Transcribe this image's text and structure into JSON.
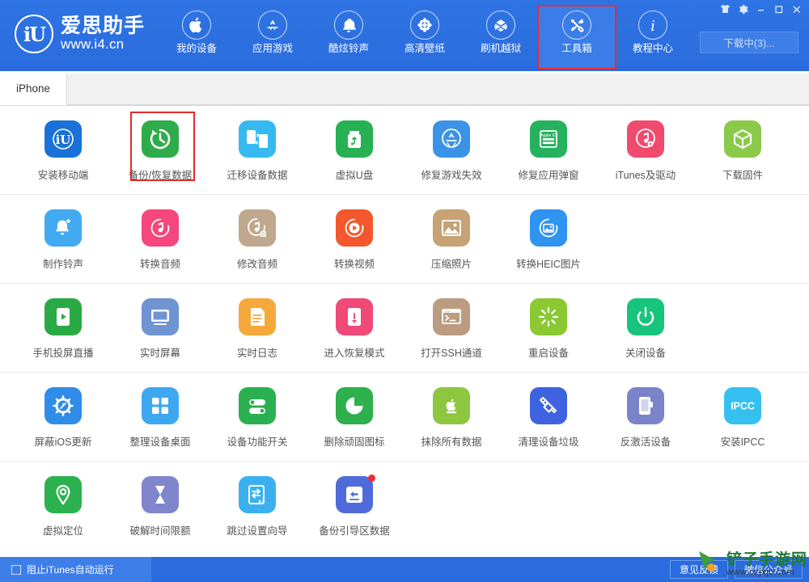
{
  "window": {
    "brand_title": "爱思助手",
    "brand_url": "www.i4.cn",
    "logo_mark": "iU",
    "controls": [
      {
        "name": "skin-icon",
        "label": "皮肤"
      },
      {
        "name": "settings-gear-icon",
        "label": "设置"
      },
      {
        "name": "minimize-icon",
        "label": "最小化"
      },
      {
        "name": "maximize-icon",
        "label": "最大化"
      },
      {
        "name": "close-icon",
        "label": "关闭"
      }
    ],
    "download_button": "下载中(3)..."
  },
  "nav": {
    "items": [
      {
        "label": "我的设备",
        "icon": "apple-icon",
        "selected": false
      },
      {
        "label": "应用游戏",
        "icon": "appstore-icon",
        "selected": false
      },
      {
        "label": "酷炫铃声",
        "icon": "bell-icon",
        "selected": false
      },
      {
        "label": "高清壁纸",
        "icon": "flower-icon",
        "selected": false
      },
      {
        "label": "刷机越狱",
        "icon": "dropbox-icon",
        "selected": false
      },
      {
        "label": "工具箱",
        "icon": "tools-icon",
        "selected": true
      },
      {
        "label": "教程中心",
        "icon": "info-icon",
        "selected": false
      }
    ]
  },
  "tabs": [
    {
      "label": "iPhone",
      "active": true
    }
  ],
  "toolbox": {
    "rows": [
      [
        {
          "label": "安装移动端",
          "icon": "i4-app-icon",
          "bg": "#1a72d8",
          "selected": false,
          "badge": false
        },
        {
          "label": "备份/恢复数据",
          "icon": "backup-restore-icon",
          "bg": "#2eac4a",
          "selected": true,
          "badge": false
        },
        {
          "label": "迁移设备数据",
          "icon": "device-transfer-icon",
          "bg": "#36b9f0",
          "selected": false,
          "badge": false
        },
        {
          "label": "虚拟U盘",
          "icon": "usb-drive-icon",
          "bg": "#27b153",
          "selected": false,
          "badge": false
        },
        {
          "label": "修复游戏失效",
          "icon": "appstore-fix-icon",
          "bg": "#3b93e8",
          "selected": false,
          "badge": false
        },
        {
          "label": "修复应用弹窗",
          "icon": "apple-id-icon",
          "bg": "#25b25f",
          "selected": false,
          "badge": false
        },
        {
          "label": "iTunes及驱动",
          "icon": "itunes-driver-icon",
          "bg": "#f04a6e",
          "selected": false,
          "badge": false
        },
        {
          "label": "下载固件",
          "icon": "firmware-box-icon",
          "bg": "#8bc94a",
          "selected": false,
          "badge": false
        }
      ],
      [
        {
          "label": "制作铃声",
          "icon": "make-ringtone-icon",
          "bg": "#41aaf0",
          "selected": false,
          "badge": false
        },
        {
          "label": "转换音频",
          "icon": "convert-audio-icon",
          "bg": "#f5467e",
          "selected": false,
          "badge": false
        },
        {
          "label": "修改音频",
          "icon": "edit-audio-icon",
          "bg": "#bfa88e",
          "selected": false,
          "badge": false
        },
        {
          "label": "转换视频",
          "icon": "convert-video-icon",
          "bg": "#f4572e",
          "selected": false,
          "badge": false
        },
        {
          "label": "压缩照片",
          "icon": "compress-photo-icon",
          "bg": "#c7a275",
          "selected": false,
          "badge": false
        },
        {
          "label": "转换HEIC图片",
          "icon": "heic-convert-icon",
          "bg": "#2f93f0",
          "selected": false,
          "badge": false
        }
      ],
      [
        {
          "label": "手机投屏直播",
          "icon": "screen-cast-icon",
          "bg": "#2aaa45",
          "selected": false,
          "badge": false
        },
        {
          "label": "实时屏幕",
          "icon": "realtime-screen-icon",
          "bg": "#6e94d1",
          "selected": false,
          "badge": false
        },
        {
          "label": "实时日志",
          "icon": "realtime-log-icon",
          "bg": "#f5a93a",
          "selected": false,
          "badge": false
        },
        {
          "label": "进入恢复模式",
          "icon": "recovery-mode-icon",
          "bg": "#f04a78",
          "selected": false,
          "badge": false
        },
        {
          "label": "打开SSH通道",
          "icon": "ssh-terminal-icon",
          "bg": "#bb9c80",
          "selected": false,
          "badge": false
        },
        {
          "label": "重启设备",
          "icon": "reboot-device-icon",
          "bg": "#8bc832",
          "selected": false,
          "badge": false
        },
        {
          "label": "关闭设备",
          "icon": "power-off-icon",
          "bg": "#18c47c",
          "selected": false,
          "badge": false
        }
      ],
      [
        {
          "label": "屏蔽iOS更新",
          "icon": "block-ios-update-icon",
          "bg": "#2f8ce8",
          "selected": false,
          "badge": false
        },
        {
          "label": "整理设备桌面",
          "icon": "organize-desktop-icon",
          "bg": "#3da8f0",
          "selected": false,
          "badge": false
        },
        {
          "label": "设备功能开关",
          "icon": "feature-toggle-icon",
          "bg": "#2ab050",
          "selected": false,
          "badge": false
        },
        {
          "label": "删除顽固图标",
          "icon": "delete-icon-icon",
          "bg": "#2eb04c",
          "selected": false,
          "badge": false
        },
        {
          "label": "抹除所有数据",
          "icon": "erase-all-icon",
          "bg": "#8dc63f",
          "selected": false,
          "badge": false
        },
        {
          "label": "清理设备垃圾",
          "icon": "clean-junk-icon",
          "bg": "#3f63e0",
          "selected": false,
          "badge": false
        },
        {
          "label": "反激活设备",
          "icon": "deactivate-device-icon",
          "bg": "#7b84c9",
          "selected": false,
          "badge": false
        },
        {
          "label": "安装IPCC",
          "icon": "ipcc-install-icon",
          "bg": "#36c0f0",
          "selected": false,
          "badge": false
        }
      ],
      [
        {
          "label": "虚拟定位",
          "icon": "virtual-location-icon",
          "bg": "#2bb24f",
          "selected": false,
          "badge": false
        },
        {
          "label": "破解时间限额",
          "icon": "crack-time-limit-icon",
          "bg": "#8086cc",
          "selected": false,
          "badge": false
        },
        {
          "label": "跳过设置向导",
          "icon": "skip-setup-icon",
          "bg": "#3bb0f0",
          "selected": false,
          "badge": false
        },
        {
          "label": "备份引导区数据",
          "icon": "backup-boot-icon",
          "bg": "#4f6bdb",
          "selected": false,
          "badge": true
        }
      ]
    ]
  },
  "statusbar": {
    "block_itunes_label": "阻止iTunes自动运行",
    "block_itunes_checked": false,
    "buttons": [
      {
        "label": "意见反馈"
      },
      {
        "label": "微信公众号"
      }
    ]
  },
  "watermark": {
    "title": "铲子手游网",
    "url": "www.czjxjc.com"
  },
  "colors": {
    "header_blue": "#2a6cdd",
    "highlight_red": "#e22b2b",
    "status_blue": "#2a6cdd"
  }
}
